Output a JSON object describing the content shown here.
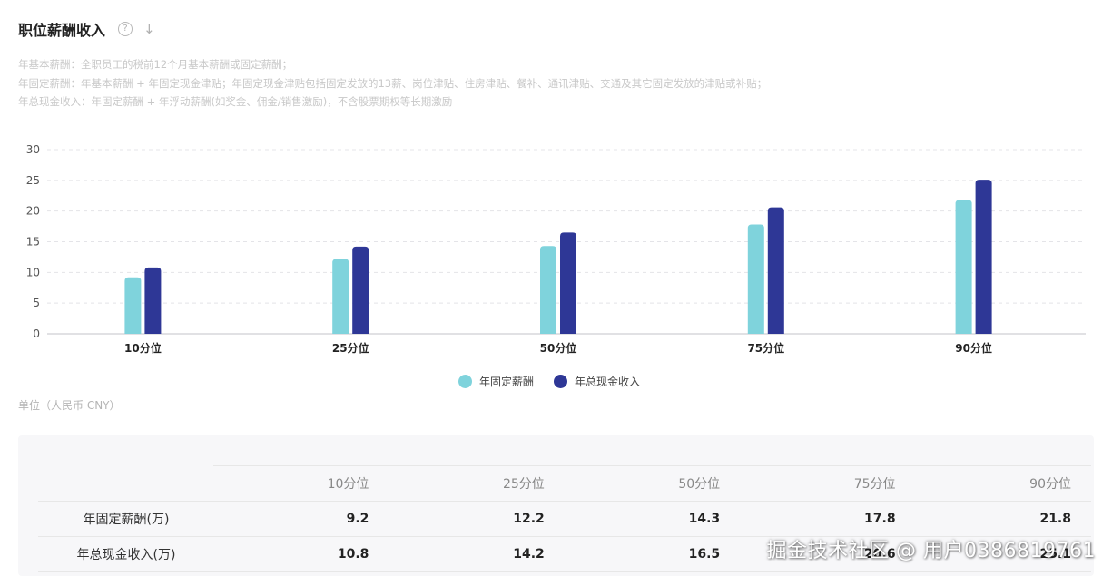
{
  "header": {
    "title": "职位薪酬收入",
    "help_icon": "?",
    "download_icon": "↓"
  },
  "descriptions": [
    "年基本薪酬：全职员工的税前12个月基本薪酬或固定薪酬；",
    "年固定薪酬：年基本薪酬 + 年固定现金津贴；年固定现金津贴包括固定发放的13薪、岗位津贴、住房津贴、餐补、通讯津贴、交通及其它固定发放的津贴或补贴；",
    "年总现金收入：年固定薪酬 + 年浮动薪酬(如奖金、佣金/销售激励)，不含股票期权等长期激励"
  ],
  "colors": {
    "series_fixed": "#7fd3dc",
    "series_total": "#2e3796"
  },
  "chart_data": {
    "type": "bar",
    "categories": [
      "10分位",
      "25分位",
      "50分位",
      "75分位",
      "90分位"
    ],
    "series": [
      {
        "name": "年固定薪酬",
        "values": [
          9.2,
          12.2,
          14.3,
          17.8,
          21.8
        ]
      },
      {
        "name": "年总现金收入",
        "values": [
          10.8,
          14.2,
          16.5,
          20.6,
          25.1
        ]
      }
    ],
    "ylim": [
      0,
      30
    ],
    "yticks": [
      "0",
      "5",
      "10",
      "15",
      "20",
      "25",
      "30"
    ],
    "grid": true,
    "legend": "bottom-center"
  },
  "unit_note": "单位（人民币 CNY）",
  "table": {
    "columns": [
      "10分位",
      "25分位",
      "50分位",
      "75分位",
      "90分位"
    ],
    "rows": [
      {
        "label": "年固定薪酬(万)",
        "values": [
          "9.2",
          "12.2",
          "14.3",
          "17.8",
          "21.8"
        ]
      },
      {
        "label": "年总现金收入(万)",
        "values": [
          "10.8",
          "14.2",
          "16.5",
          "20.6",
          "25.1"
        ]
      }
    ]
  },
  "watermark": "掘金技术社区 @ 用户0386819761"
}
